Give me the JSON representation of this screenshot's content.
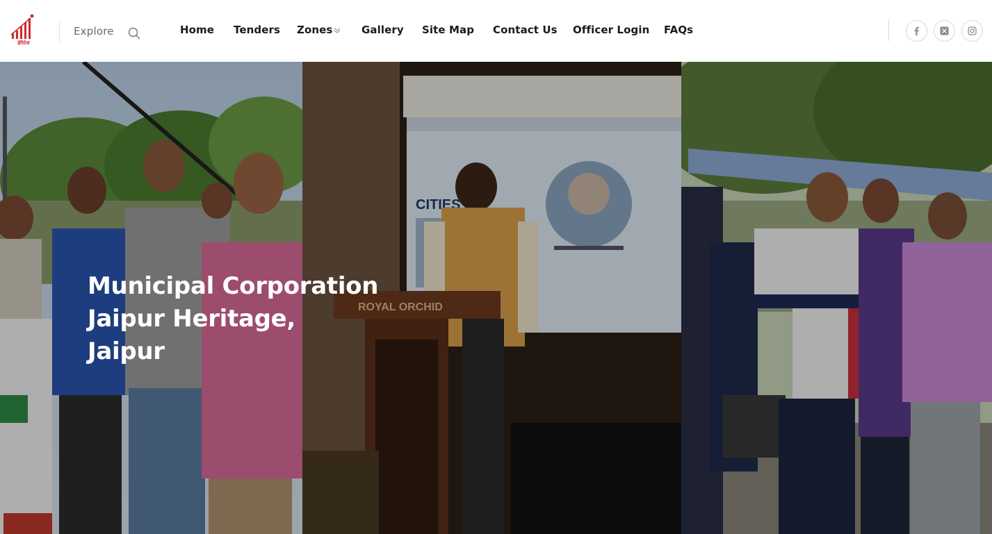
{
  "header": {
    "logo_text": "हेरिटेज",
    "explore_label": "Explore",
    "nav": [
      {
        "label": "Home"
      },
      {
        "label": "Tenders"
      },
      {
        "label": "Zones",
        "has_dropdown": true
      },
      {
        "label": "Gallery"
      },
      {
        "label": "Site Map"
      },
      {
        "label": "Contact Us"
      },
      {
        "label": "Officer Login"
      },
      {
        "label": "FAQs"
      }
    ],
    "social": [
      "facebook-icon",
      "x-icon",
      "instagram-icon"
    ]
  },
  "hero": {
    "title_lines": [
      "Municipal Corporation",
      "Jaipur Heritage,",
      "Jaipur"
    ],
    "screen_text": "CITIES FO",
    "podium_text": "ROYAL ORCHID"
  },
  "colors": {
    "brand_red": "#d12a2a",
    "nav_text": "#1b1b1b"
  }
}
